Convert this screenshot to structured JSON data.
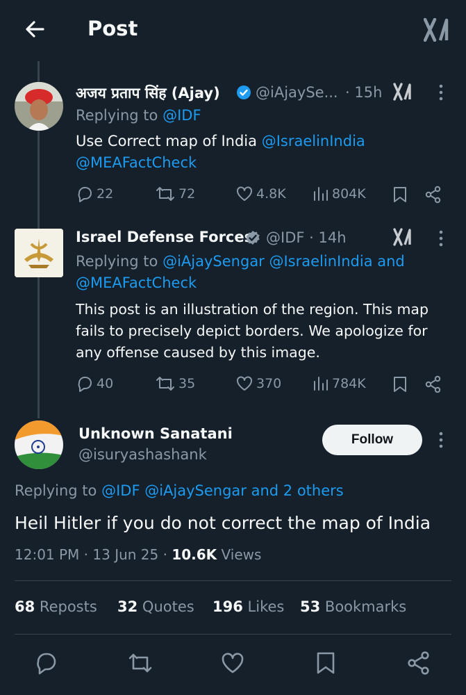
{
  "header": {
    "title": "Post"
  },
  "reply1": {
    "name": "अजय प्रताप सिंह (Ajay)",
    "handle": "@iAjaySe...",
    "time": "· 15h",
    "replying_label": "Replying to",
    "replying_to": "@IDF",
    "text_plain": "Use Correct map of India",
    "mention1": "@IsraelinIndia",
    "mention2": "@MEAFactCheck",
    "replies": "22",
    "reposts": "72",
    "likes": "4.8K",
    "views": "804K"
  },
  "reply2": {
    "name": "Israel Defense Forces",
    "handle": "@IDF · 14h",
    "replying_label": "Replying to",
    "replying_to": "@iAjaySengar @IsraelinIndia and",
    "replying_to2": "@MEAFactCheck",
    "text_line1": "This post is an illustration of the region. This map",
    "text_line2": "fails to precisely depict borders. We apologize for",
    "text_line3": "any offense caused by this image.",
    "replies": "40",
    "reposts": "35",
    "likes": "370",
    "views": "784K"
  },
  "main": {
    "name": "Unknown Sanatani",
    "handle": "@isuryashashank",
    "follow_label": "Follow",
    "replying_label": "Replying to",
    "replying_to": "@IDF @iAjaySengar and 2 others",
    "text": "Heil Hitler if you do not correct the map of India",
    "timestamp": "12:01 PM · 13 Jun 25 ·",
    "views_count": "10.6K",
    "views_label": "Views"
  },
  "stats": {
    "reposts_count": "68",
    "reposts_label": "Reposts",
    "quotes_count": "32",
    "quotes_label": "Quotes",
    "likes_count": "196",
    "likes_label": "Likes",
    "bookmarks_count": "53",
    "bookmarks_label": "Bookmarks"
  },
  "colors": {
    "background": "#15202b",
    "link": "#1d9bf0",
    "muted": "#8b98a5",
    "divider": "#38444d"
  }
}
